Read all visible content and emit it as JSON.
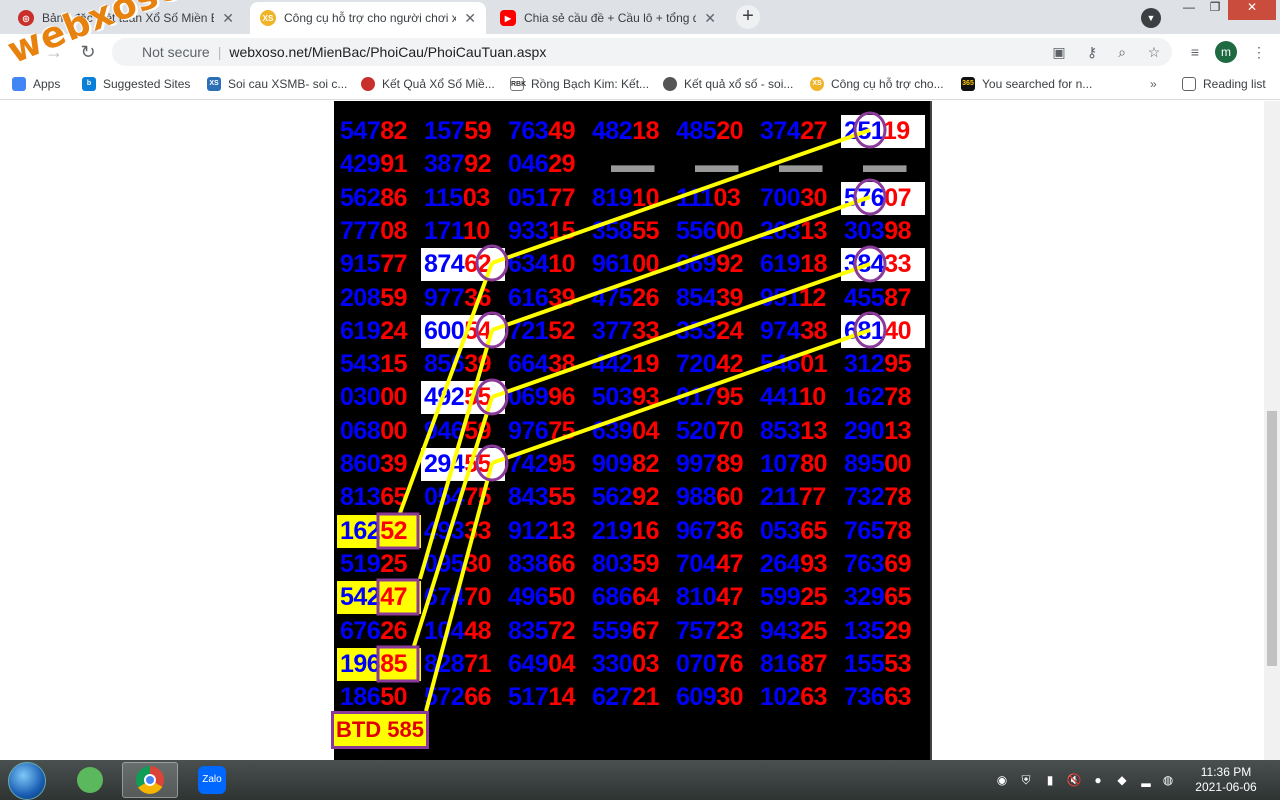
{
  "watermark": "webxoso.net",
  "tabs": [
    {
      "title": "Bảng đặc biệt tuần Xổ Số Miền Bắc",
      "icon": "lottery-icon",
      "color": "#c9302c"
    },
    {
      "title": "Công cụ hỗ trợ cho người chơi xổ số",
      "icon": "xs-coin-icon",
      "color": "#f0b429"
    },
    {
      "title": "Chia sẻ cầu đề + Cầu lô + tổng đề",
      "icon": "youtube-icon",
      "color": "#ff0000"
    }
  ],
  "address": {
    "security": "Not secure",
    "url": "webxoso.net/MienBac/PhoiCau/PhoiCauTuan.aspx"
  },
  "bookmarks": [
    {
      "label": "Apps"
    },
    {
      "label": "Suggested Sites"
    },
    {
      "label": "Soi cau XSMB- soi c..."
    },
    {
      "label": "Kết Quả Xổ Số Miề..."
    },
    {
      "label": "Rồng Bạch Kim: Kết..."
    },
    {
      "label": "Kết quả xổ số - soi..."
    },
    {
      "label": "Công cụ hỗ trợ cho..."
    },
    {
      "label": "You searched for n..."
    }
  ],
  "reading_list": "Reading list",
  "profile_initial": "m",
  "grid": [
    [
      "54782",
      "15759",
      "76349",
      "48218",
      "48520",
      "37427",
      "25119"
    ],
    [
      "42991",
      "38792",
      "04629",
      "-----",
      "-----",
      "-----",
      "-----"
    ],
    [
      "56286",
      "11503",
      "05177",
      "81910",
      "11103",
      "70030",
      "57607"
    ],
    [
      "77708",
      "17110",
      "93315",
      "35855",
      "55600",
      "26313",
      "30398"
    ],
    [
      "91577",
      "87462",
      "63410",
      "96100",
      "66992",
      "61918",
      "38433"
    ],
    [
      "20859",
      "97736",
      "61639",
      "47526",
      "85439",
      "95112",
      "45587"
    ],
    [
      "61924",
      "60054",
      "72152",
      "37733",
      "35324",
      "97438",
      "68140"
    ],
    [
      "54315",
      "85639",
      "66438",
      "44219",
      "72042",
      "54601",
      "31295"
    ],
    [
      "03000",
      "49255",
      "06996",
      "50393",
      "01795",
      "44110",
      "16278"
    ],
    [
      "06800",
      "94659",
      "97675",
      "63904",
      "52070",
      "85313",
      "29013"
    ],
    [
      "86039",
      "29455",
      "74295",
      "90982",
      "99789",
      "10780",
      "89500"
    ],
    [
      "81365",
      "05475",
      "84355",
      "56292",
      "98860",
      "21177",
      "73278"
    ],
    [
      "16252",
      "49333",
      "91213",
      "21916",
      "96736",
      "05365",
      "76578"
    ],
    [
      "51925",
      "09530",
      "83866",
      "80359",
      "70447",
      "26493",
      "76369"
    ],
    [
      "54247",
      "67470",
      "49650",
      "68664",
      "81047",
      "59925",
      "32965"
    ],
    [
      "67626",
      "10448",
      "83572",
      "55967",
      "75723",
      "94325",
      "13529"
    ],
    [
      "19685",
      "82871",
      "64904",
      "33003",
      "07076",
      "81687",
      "15553"
    ],
    [
      "18650",
      "57266",
      "51714",
      "62721",
      "60930",
      "10263",
      "73663"
    ]
  ],
  "circled_digits": [
    "2",
    "4",
    "5",
    "5",
    "5",
    "7",
    "8",
    "8"
  ],
  "boxed_results": [
    "52",
    "47",
    "85"
  ],
  "btd_label": "BTD 585",
  "clock": {
    "time": "11:36 PM",
    "date": "2021-06-06"
  },
  "taskbar_apps": [
    "Chrome",
    "Zalo"
  ]
}
